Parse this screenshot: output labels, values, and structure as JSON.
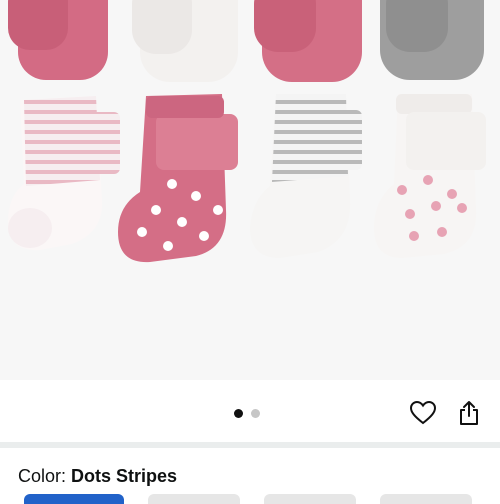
{
  "product": {
    "image_alt": "Baby socks 8-pack",
    "gallery_count": 2,
    "gallery_active": 1,
    "variation": {
      "label": "Color: ",
      "value": "Dots Stripes"
    }
  },
  "actions": {
    "favorite_icon": "heart-icon",
    "share_icon": "share-icon"
  },
  "colors": {
    "accent": "#2162c9",
    "sock_pink": "#d36b84",
    "sock_gray": "#9e9e9e",
    "sock_white": "#f5f3f2"
  }
}
